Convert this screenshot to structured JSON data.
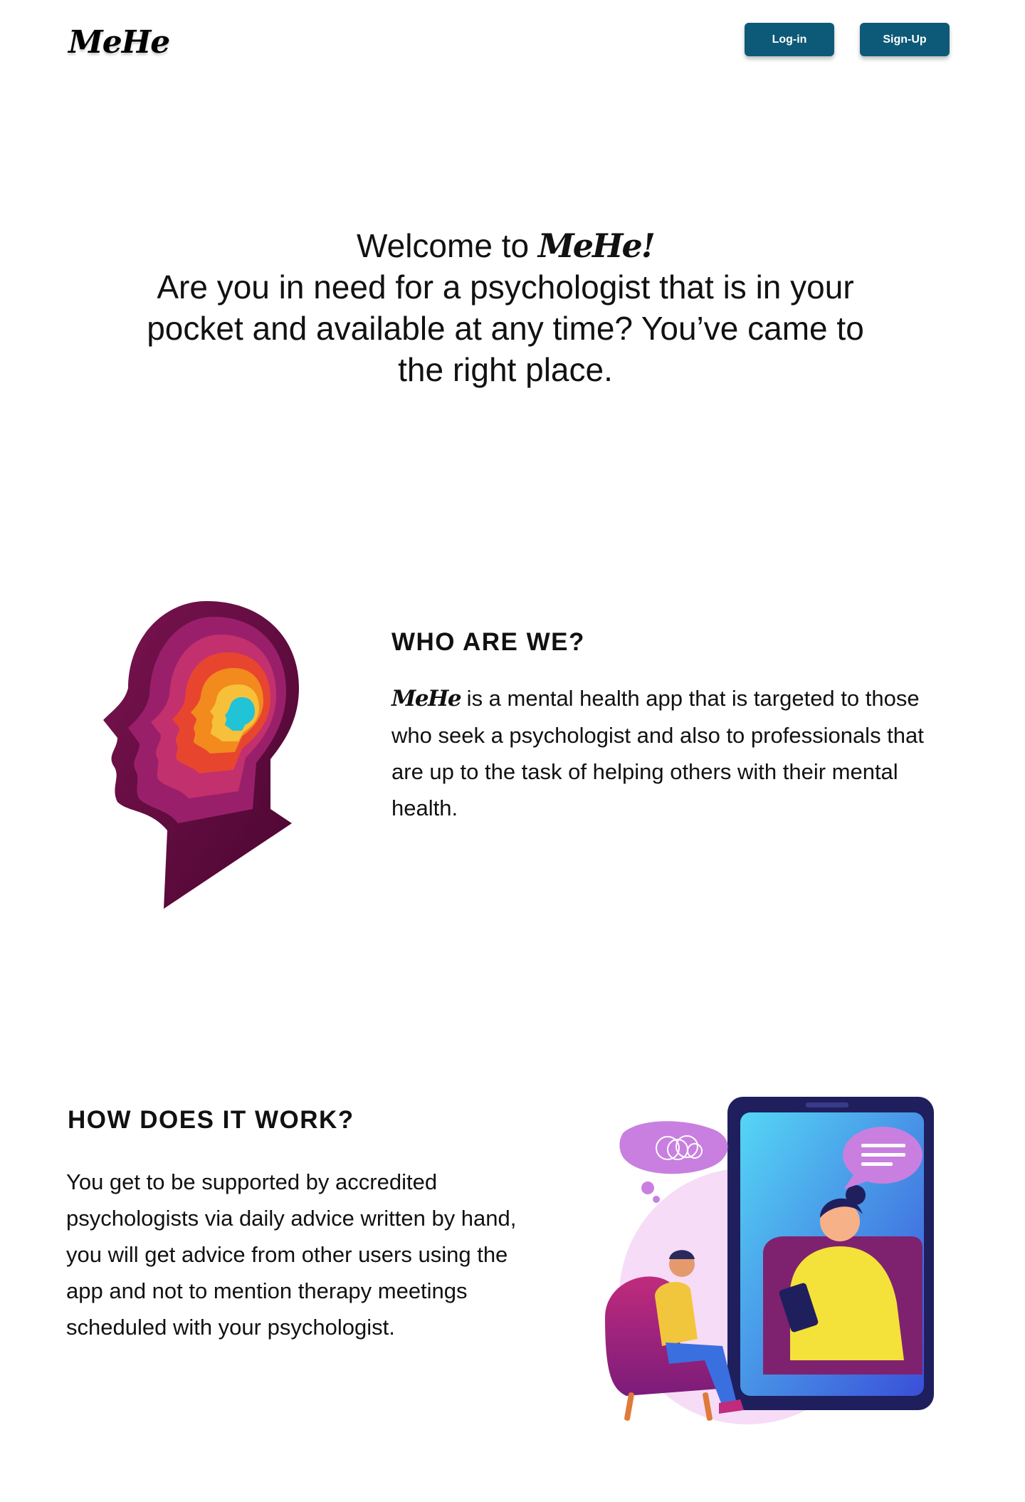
{
  "header": {
    "logo": "MeHe",
    "login_label": "Log-in",
    "signup_label": "Sign-Up"
  },
  "hero": {
    "welcome_prefix": "Welcome to ",
    "brand": "MeHe!",
    "text": "Are you in need for a psychologist that is in your pocket and available at any time? You’ve came to the right place."
  },
  "who": {
    "title": "WHO ARE WE?",
    "brand": "MeHe",
    "text": " is a mental health app that is targeted to those who seek a psychologist and also to professionals that are up to the task of helping others with their mental health."
  },
  "how": {
    "title": "HOW DOES IT WORK?",
    "text": "You get to be supported by accredited psychologists via daily advice written by hand, you will get advice from other users using the app and not to mention therapy meetings scheduled with your psychologist."
  },
  "colors": {
    "button_bg": "#0d5a78",
    "button_text": "#ffffff",
    "text": "#111111"
  }
}
